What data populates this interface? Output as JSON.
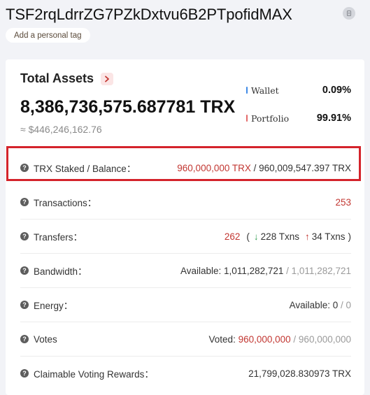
{
  "account": {
    "address": "TSF2rqLdrrZG7PZkDxtvu6B2PTpofidMAX",
    "tag_label": "Add a personal tag"
  },
  "summary": {
    "title": "Total Assets",
    "amount": "8,386,736,575.687781 TRX",
    "usd": "≈ $446,246,162.76",
    "legend": [
      {
        "label": "Wallet",
        "pct": "0.09%",
        "color": "#3f8ae6"
      },
      {
        "label": "Portfolio",
        "pct": "99.91%",
        "color": "#e46a6a"
      }
    ]
  },
  "rows": {
    "staked": {
      "label": "TRX Staked / Balance：",
      "value": "960,000,000 TRX",
      "sep": " / ",
      "total": "960,009,547.397 TRX"
    },
    "transactions": {
      "label": "Transactions：",
      "value": "253"
    },
    "transfers": {
      "label": "Transfers：",
      "value": "262",
      "open": "(",
      "in": "228 Txns",
      "out": "34 Txns",
      "close": ")"
    },
    "bandwidth": {
      "label": "Bandwidth：",
      "prefix": "Available: ",
      "value": "1,011,282,721",
      "sep": " / ",
      "total": "1,011,282,721"
    },
    "energy": {
      "label": "Energy：",
      "prefix": "Available: ",
      "value": "0",
      "sep": " / ",
      "total": "0"
    },
    "votes": {
      "label": "Votes",
      "prefix": "Voted: ",
      "value": "960,000,000",
      "sep": " / ",
      "total": "960,000,000"
    },
    "rewards": {
      "label": "Claimable Voting Rewards：",
      "value": "21,799,028.830973 TRX"
    }
  },
  "colors": {
    "accent": "#c23631",
    "highlight": "#d4232b",
    "down_arrow": "#2e9d4f"
  }
}
